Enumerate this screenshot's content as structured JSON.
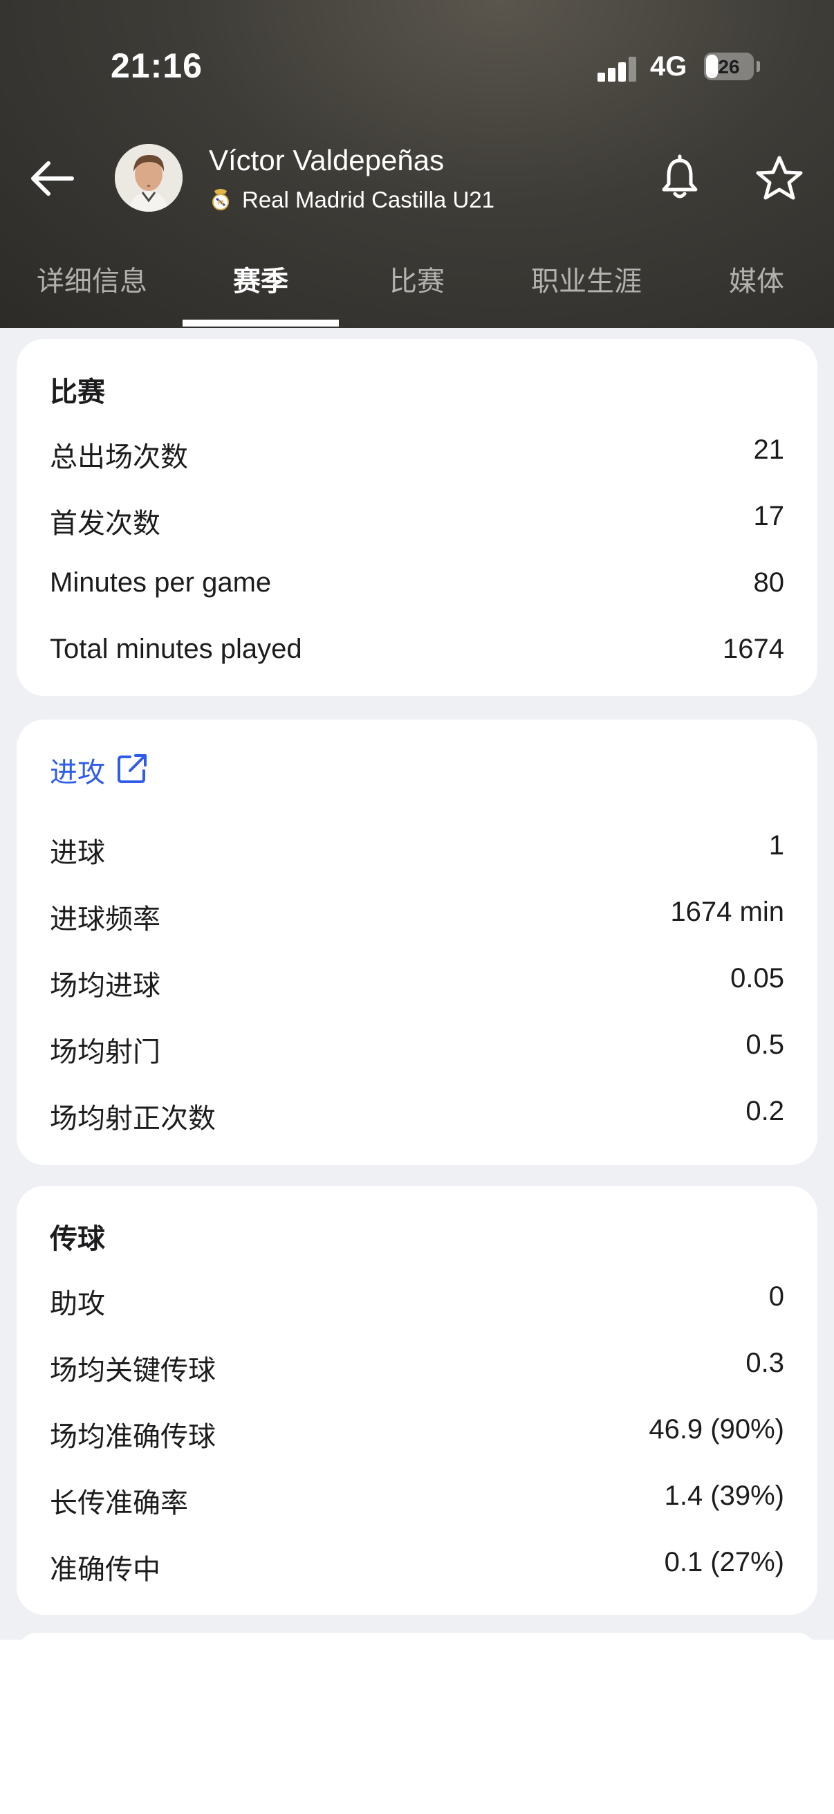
{
  "status_bar": {
    "time": "21:16",
    "network": "4G",
    "battery": "26",
    "battery_level": 0.26
  },
  "header": {
    "player_name": "Víctor Valdepeñas",
    "club_name": "Real Madrid Castilla U21",
    "icons": {
      "back": "back-arrow-icon",
      "bell": "bell-icon",
      "star": "star-icon"
    }
  },
  "tabs": [
    {
      "label": "详细信息",
      "active": false
    },
    {
      "label": "赛季",
      "active": true
    },
    {
      "label": "比赛",
      "active": false
    },
    {
      "label": "职业生涯",
      "active": false
    },
    {
      "label": "媒体",
      "active": false
    }
  ],
  "sections": {
    "matches": {
      "title": "比赛",
      "rows": [
        {
          "label": "总出场次数",
          "value": "21"
        },
        {
          "label": "首发次数",
          "value": "17"
        },
        {
          "label": "Minutes per game",
          "value": "80"
        },
        {
          "label": "Total minutes played",
          "value": "1674"
        }
      ]
    },
    "attack": {
      "title": "进攻",
      "rows": [
        {
          "label": "进球",
          "value": "1"
        },
        {
          "label": "进球频率",
          "value": "1674 min"
        },
        {
          "label": "场均进球",
          "value": "0.05"
        },
        {
          "label": "场均射门",
          "value": "0.5"
        },
        {
          "label": "场均射正次数",
          "value": "0.2"
        }
      ]
    },
    "passing": {
      "title": "传球",
      "rows": [
        {
          "label": "助攻",
          "value": "0"
        },
        {
          "label": "场均关键传球",
          "value": "0.3"
        },
        {
          "label": "场均准确传球",
          "value": "46.9 (90%)"
        },
        {
          "label": "长传准确率",
          "value": "1.4 (39%)"
        },
        {
          "label": "准确传中",
          "value": "0.1 (27%)"
        }
      ]
    }
  },
  "colors": {
    "link_blue": "#2f5ce8",
    "background": "#eef0f4",
    "card": "#ffffff"
  }
}
